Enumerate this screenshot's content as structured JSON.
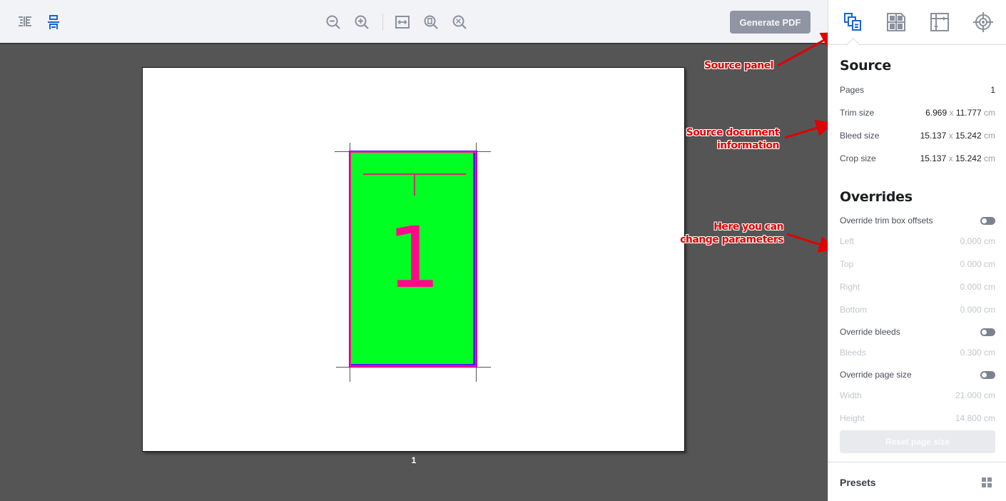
{
  "toolbar": {
    "view_buttons": [
      {
        "icon": "side-by-side-view-icon",
        "active": false
      },
      {
        "icon": "stacked-view-icon",
        "active": true
      }
    ],
    "zoom_buttons": [
      {
        "icon": "zoom-out-icon"
      },
      {
        "icon": "zoom-in-icon"
      },
      {
        "icon": "fit-width-icon"
      },
      {
        "icon": "fit-page-icon"
      },
      {
        "icon": "fit-all-icon"
      }
    ],
    "generate_label": "Generate PDF"
  },
  "canvas": {
    "page_number": "1",
    "page_content_number": "1",
    "colors": {
      "trim_fill": "#00ff22",
      "trim_border": "#ff1493",
      "bleed_border": "#6a00ff",
      "number_color": "#ff0a8c"
    }
  },
  "annotations": [
    {
      "text": "Source panel"
    },
    {
      "text": "Source document information"
    },
    {
      "text": "Here you can change parameters"
    }
  ],
  "panel": {
    "tabs": [
      {
        "icon": "source-pages-icon",
        "active": true
      },
      {
        "icon": "layout-grid-icon",
        "active": false
      },
      {
        "icon": "page-dimensions-icon",
        "active": false
      },
      {
        "icon": "marks-target-icon",
        "active": false
      }
    ],
    "source": {
      "title": "Source",
      "pages_label": "Pages",
      "pages_value": "1",
      "trim_label": "Trim size",
      "trim_w": "6.969",
      "trim_h": "11.777",
      "bleed_label": "Bleed size",
      "bleed_w": "15.137",
      "bleed_h": "15.242",
      "crop_label": "Crop size",
      "crop_w": "15.137",
      "crop_h": "15.242",
      "times": "x",
      "unit": "cm"
    },
    "overrides": {
      "title": "Overrides",
      "trim_toggle_label": "Override trim box offsets",
      "trim_toggle_on": false,
      "left_label": "Left",
      "left_value": "0.000 cm",
      "top_label": "Top",
      "top_value": "0.000 cm",
      "right_label": "Right",
      "right_value": "0.000 cm",
      "bottom_label": "Bottom",
      "bottom_value": "0.000 cm",
      "bleeds_toggle_label": "Override bleeds",
      "bleeds_toggle_on": false,
      "bleeds_label": "Bleeds",
      "bleeds_value": "0.300 cm",
      "pagesize_toggle_label": "Override page size",
      "pagesize_toggle_on": false,
      "width_label": "Width",
      "width_value": "21.000 cm",
      "height_label": "Height",
      "height_value": "14.800 cm",
      "reset_label": "Reset page size"
    },
    "presets_label": "Presets"
  }
}
